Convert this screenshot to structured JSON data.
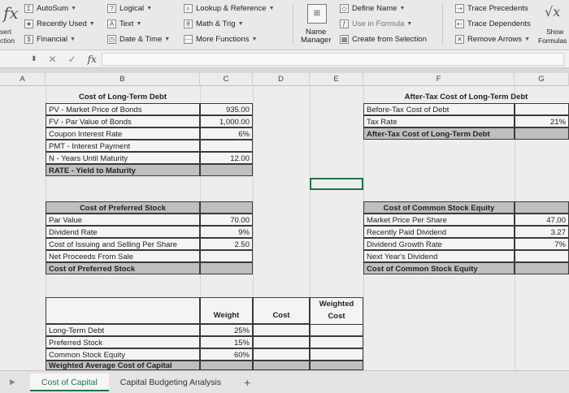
{
  "ribbon": {
    "insert_label": "sert",
    "function_label": "ction",
    "autosum": "AutoSum",
    "recently_used": "Recently Used",
    "financial": "Financial",
    "logical": "Logical",
    "text": "Text",
    "date_time": "Date & Time",
    "lookup_reference": "Lookup & Reference",
    "math_trig": "Math & Trig",
    "more_functions": "More Functions",
    "name_manager_1": "Name",
    "name_manager_2": "Manager",
    "define_name": "Define Name",
    "use_in_formula": "Use in Formula",
    "create_from_selection": "Create from Selection",
    "trace_precedents": "Trace Precedents",
    "trace_dependents": "Trace Dependents",
    "remove_arrows": "Remove Arrows",
    "show_formulas_1": "Show",
    "show_formulas_2": "Formulas"
  },
  "formula_bar": {
    "fx": "fx"
  },
  "columns": [
    "A",
    "B",
    "C",
    "D",
    "E",
    "F",
    "G"
  ],
  "debt": {
    "title": "Cost of Long-Term Debt",
    "rows": [
      {
        "label": "PV - Market Price of Bonds",
        "value": "935.00"
      },
      {
        "label": "FV - Par Value of Bonds",
        "value": "1,000.00"
      },
      {
        "label": "Coupon Interest Rate",
        "value": "6%"
      },
      {
        "label": "PMT - Interest Payment",
        "value": ""
      },
      {
        "label": "N - Years Until Maturity",
        "value": "12.00"
      }
    ],
    "result": "RATE - Yield to Maturity"
  },
  "aftertax": {
    "title": "After-Tax Cost of Long-Term Debt",
    "rows": [
      {
        "label": "Before-Tax Cost of Debt",
        "value": ""
      },
      {
        "label": "Tax Rate",
        "value": "21%"
      }
    ],
    "result": "After-Tax Cost of Long-Term Debt"
  },
  "preferred": {
    "title": "Cost of Preferred Stock",
    "rows": [
      {
        "label": "Par Value",
        "value": "70.00"
      },
      {
        "label": "Dividend Rate",
        "value": "9%"
      },
      {
        "label": "Cost of Issuing and Selling Per Share",
        "value": "2.50"
      },
      {
        "label": "Net Proceeds From Sale",
        "value": ""
      }
    ],
    "result": "Cost of Preferred Stock"
  },
  "common": {
    "title": "Cost of Common Stock Equity",
    "rows": [
      {
        "label": "Market Price Per Share",
        "value": "47.00"
      },
      {
        "label": "Recently Paid Dividend",
        "value": "3.27"
      },
      {
        "label": "Dividend Growth Rate",
        "value": "7%"
      },
      {
        "label": "Next Year's Dividend",
        "value": ""
      }
    ],
    "result": "Cost of Common Stock Equity"
  },
  "wacc": {
    "hdr_weight": "Weight",
    "hdr_cost": "Cost",
    "hdr_weighted_1": "Weighted",
    "hdr_weighted_2": "Cost",
    "rows": [
      {
        "label": "Long-Term Debt",
        "weight": "25%"
      },
      {
        "label": "Preferred Stock",
        "weight": "15%"
      },
      {
        "label": "Common Stock Equity",
        "weight": "60%"
      }
    ],
    "result": "Weighted Average Cost of Capital"
  },
  "tabs": [
    "Cost of Capital",
    "Capital Budgeting Analysis"
  ],
  "add_sheet": "+"
}
